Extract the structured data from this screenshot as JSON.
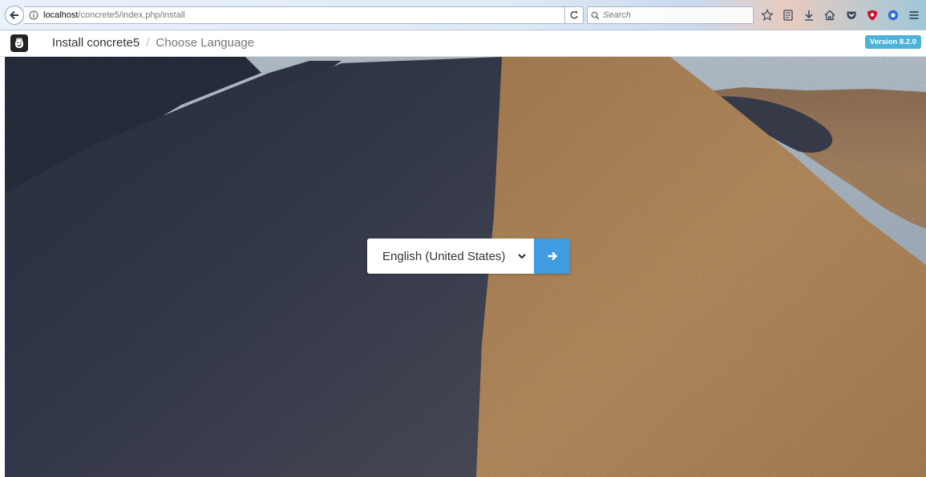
{
  "browser": {
    "url_host": "localhost",
    "url_path": "/concrete5/index.php/install",
    "search_placeholder": "Search",
    "toolbar_icons": [
      "star-icon",
      "reading-list-icon",
      "download-icon",
      "home-icon",
      "pocket-icon",
      "ublock-icon",
      "extension-icon",
      "menu-icon"
    ]
  },
  "header": {
    "app_title": "Install concrete5",
    "separator": "/",
    "step_title": "Choose Language",
    "version": "Version 8.2.0"
  },
  "language_form": {
    "selected_language": "English (United States)"
  },
  "colors": {
    "accent": "#3f9ce0",
    "version_badge": "#4bb3d9"
  }
}
